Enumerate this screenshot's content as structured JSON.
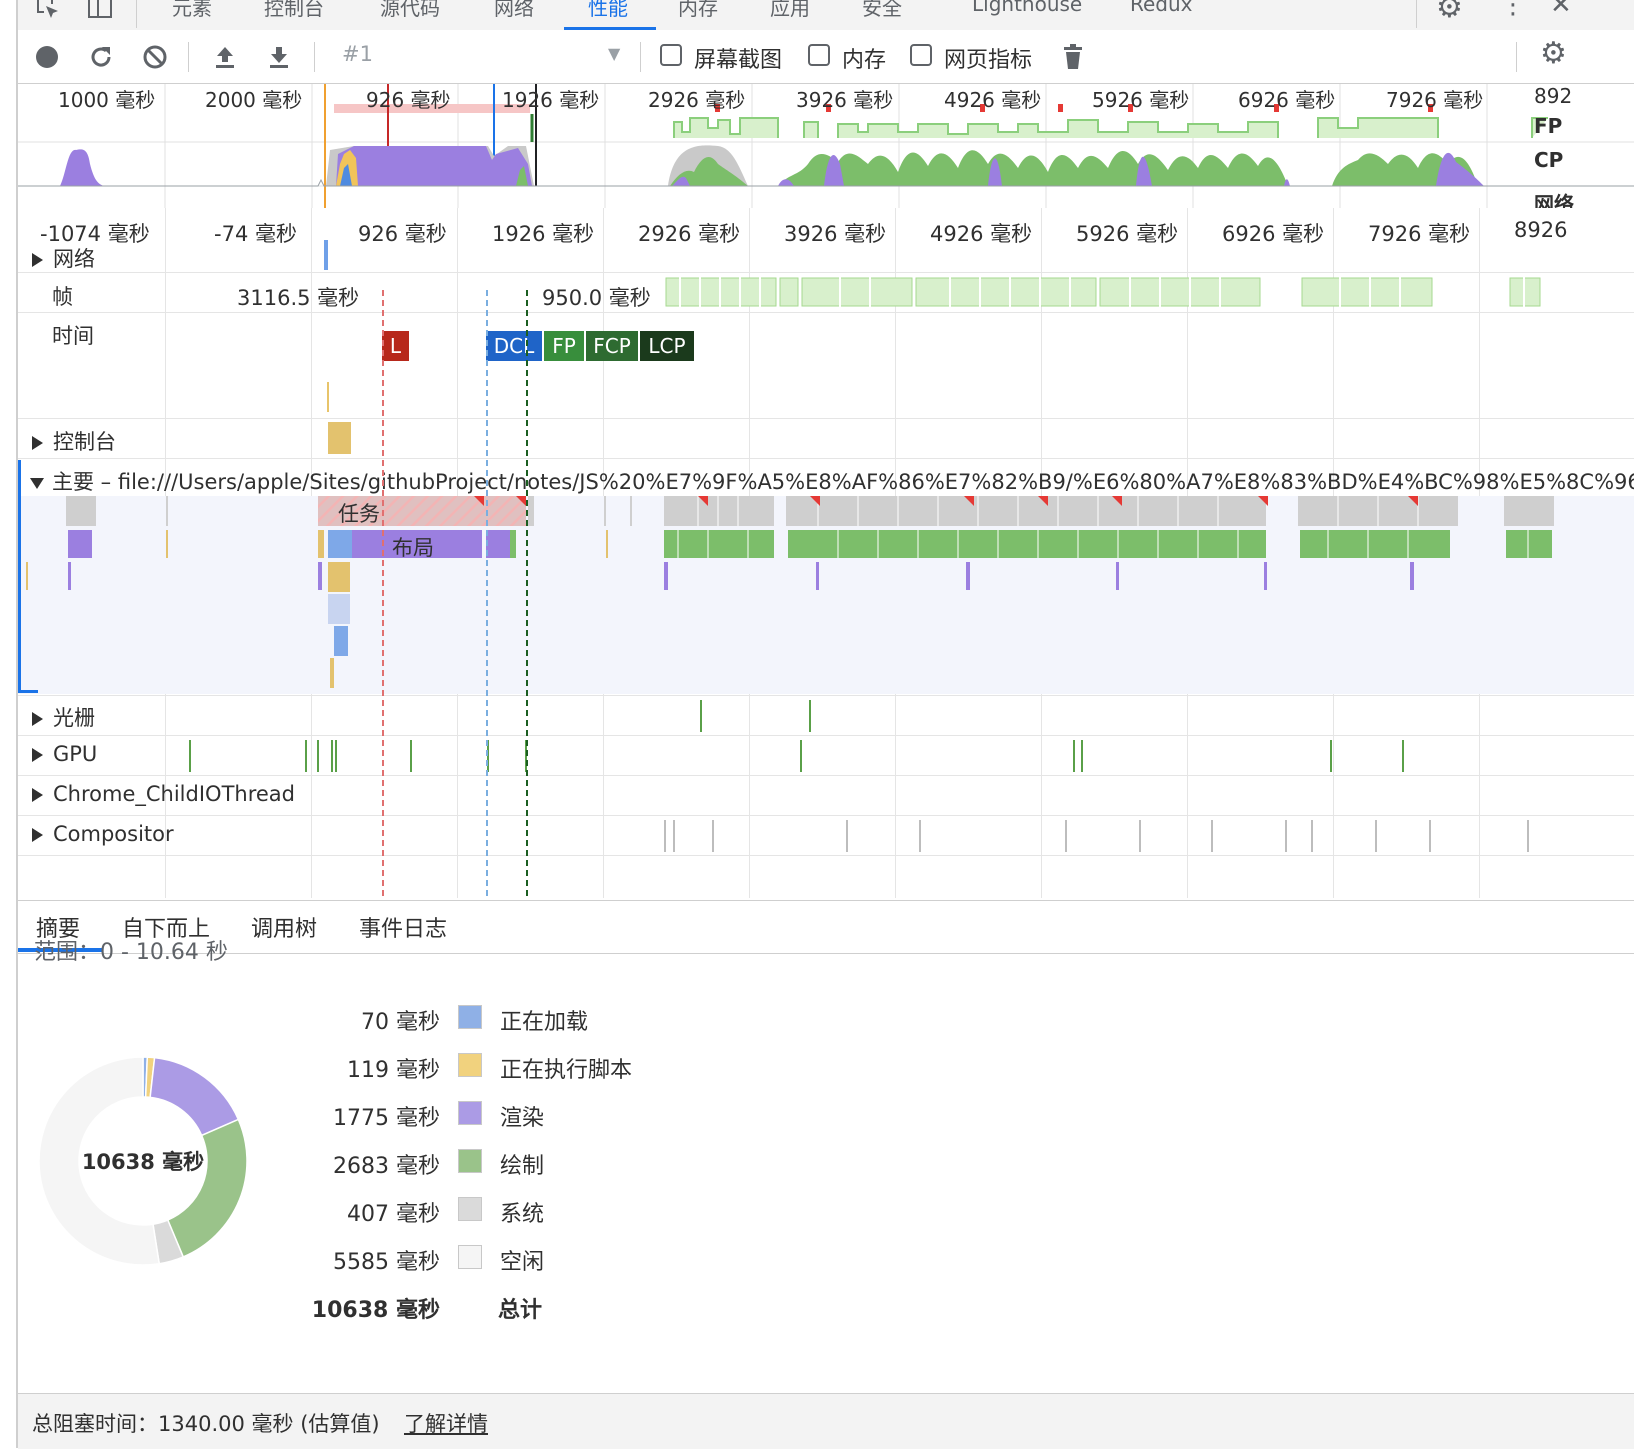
{
  "tabs": [
    "元素",
    "控制台",
    "源代码",
    "网络",
    "性能",
    "内存",
    "应用",
    "安全",
    "Lighthouse",
    "Redux"
  ],
  "active_tab": "性能",
  "toolbar": {
    "profile_select": "#1",
    "screenshots": "屏幕截图",
    "memory": "内存",
    "web_vitals": "网页指标"
  },
  "overview": {
    "ticks": [
      "1000 毫秒",
      "2000 毫秒",
      "926 毫秒",
      "1926 毫秒",
      "2926 毫秒",
      "3926 毫秒",
      "4926 毫秒",
      "5926 毫秒",
      "6926 毫秒",
      "7926 毫秒",
      "892"
    ],
    "side_labels": [
      "FP",
      "CP",
      "网络"
    ]
  },
  "ruler": [
    "-1074 毫秒",
    "-74 毫秒",
    "926 毫秒",
    "1926 毫秒",
    "2926 毫秒",
    "3926 毫秒",
    "4926 毫秒",
    "5926 毫秒",
    "6926 毫秒",
    "7926 毫秒",
    "8926"
  ],
  "tracks": {
    "network": "网络",
    "frames": "帧",
    "frame_1": "3116.5 毫秒",
    "frame_2": "950.0 毫秒",
    "timings": "时间",
    "console": "控制台",
    "main": "主要 – file:///Users/apple/Sites/githubProject/notes/JS%20%E7%9F%A5%E8%AF%86%E7%82%B9/%E6%80%A7%E8%83%BD%E4%BC%98%E5%8C%96/%E5%",
    "task": "任务",
    "layout": "布局",
    "raster": "光栅",
    "gpu": "GPU",
    "io": "Chrome_ChildIOThread",
    "compositor": "Compositor"
  },
  "timing_marks": [
    "L",
    "DCL",
    "FP",
    "FCP",
    "LCP"
  ],
  "bottom_tabs": [
    "摘要",
    "自下而上",
    "调用树",
    "事件日志"
  ],
  "summary": {
    "range": "范围：0 - 10.64 秒",
    "total_center": "10638 毫秒",
    "items": [
      {
        "value": "70 毫秒",
        "name": "正在加载",
        "ms": 70,
        "color": "#8fb0e6"
      },
      {
        "value": "119 毫秒",
        "name": "正在执行脚本",
        "ms": 119,
        "color": "#f1d27e"
      },
      {
        "value": "1775 毫秒",
        "name": "渲染",
        "ms": 1775,
        "color": "#ab9be5"
      },
      {
        "value": "2683 毫秒",
        "name": "绘制",
        "ms": 2683,
        "color": "#9ac38a"
      },
      {
        "value": "407 毫秒",
        "name": "系统",
        "ms": 407,
        "color": "#dadada"
      },
      {
        "value": "5585 毫秒",
        "name": "空闲",
        "ms": 5585,
        "color": "#f5f5f5"
      }
    ],
    "total_value": "10638 毫秒",
    "total_name": "总计"
  },
  "footer": {
    "text": "总阻塞时间：1340.00 毫秒 (估算值)",
    "link": "了解详情"
  }
}
